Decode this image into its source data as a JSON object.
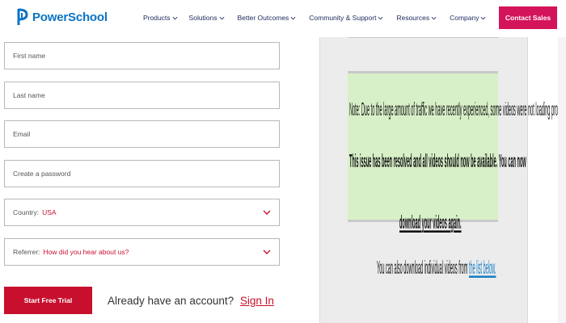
{
  "header": {
    "logo_text": "PowerSchool",
    "nav": [
      "Products",
      "Solutions",
      "Better Outcomes",
      "Community & Support",
      "Resources",
      "Company"
    ],
    "contact_label": "Contact Sales"
  },
  "form": {
    "first_name_placeholder": "First name",
    "last_name_placeholder": "Last name",
    "email_placeholder": "Email",
    "password_placeholder": "Create a password",
    "country_label": "Country:",
    "country_value": "USA",
    "referrer_label": "Referrer:",
    "referrer_value": "How did you hear about us?",
    "start_label": "Start Free Trial",
    "already_text": "Already have an account?",
    "signin_label": "Sign In"
  },
  "notice": {
    "line1": "Note: Due to the large amount of traffic we have recently experienced, some videos were not loading properly.",
    "line2": "This issue has been resolved and all videos should now be available. You can now",
    "line3": "download your videos again.",
    "line4_text": "You can also download individual videos from",
    "line4_link": "the list below."
  },
  "colors": {
    "brand_blue": "#0b74c3",
    "accent_red": "#c8102e",
    "contact_pink": "#d4145a",
    "notice_green": "#d8f0c8"
  }
}
